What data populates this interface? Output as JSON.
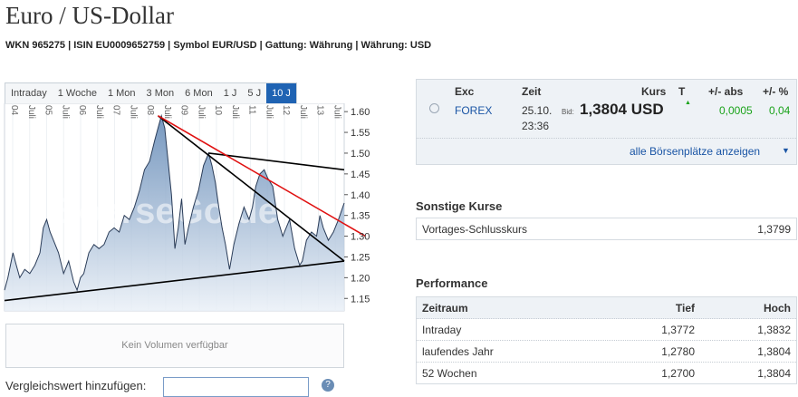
{
  "header": {
    "title": "Euro / US-Dollar",
    "meta": "WKN 965275 | ISIN EU0009652759 | Symbol EUR/USD | Gattung: Währung | Währung: USD"
  },
  "range_tabs": [
    "Intraday",
    "1 Woche",
    "1 Mon",
    "3 Mon",
    "6 Mon",
    "1 J",
    "5 J",
    "10 J"
  ],
  "active_tab": "10 J",
  "chart_data": {
    "type": "area",
    "watermark": "BoerseGo.de",
    "x_labels": [
      "04",
      "Juli",
      "05",
      "Juli",
      "06",
      "Juli",
      "07",
      "Juli",
      "08",
      "Juli",
      "09",
      "Juli",
      "10",
      "Juli",
      "11",
      "Juli",
      "12",
      "Juli",
      "13",
      "Juli"
    ],
    "y_ticks": [
      "1.60",
      "1.55",
      "1.50",
      "1.45",
      "1.40",
      "1.35",
      "1.30",
      "1.25",
      "1.20",
      "1.15"
    ],
    "ylim": [
      1.12,
      1.62
    ],
    "xlim": [
      2003.75,
      2013.82
    ],
    "series": [
      {
        "x": [
          2003.75,
          2003.85,
          2004.0,
          2004.1,
          2004.2,
          2004.35,
          2004.5,
          2004.65,
          2004.8,
          2004.9,
          2005.0,
          2005.1,
          2005.2,
          2005.35,
          2005.5,
          2005.65,
          2005.8,
          2005.9,
          2006.0,
          2006.1,
          2006.25,
          2006.4,
          2006.55,
          2006.7,
          2006.85,
          2007.0,
          2007.15,
          2007.3,
          2007.45,
          2007.6,
          2007.75,
          2007.9,
          2008.05,
          2008.2,
          2008.3,
          2008.4,
          2008.5,
          2008.6,
          2008.7,
          2008.8,
          2008.9,
          2009.0,
          2009.1,
          2009.2,
          2009.35,
          2009.5,
          2009.65,
          2009.8,
          2009.9,
          2010.0,
          2010.1,
          2010.2,
          2010.3,
          2010.42,
          2010.55,
          2010.7,
          2010.85,
          2011.0,
          2011.1,
          2011.2,
          2011.32,
          2011.45,
          2011.55,
          2011.7,
          2011.85,
          2012.0,
          2012.1,
          2012.2,
          2012.35,
          2012.5,
          2012.58,
          2012.7,
          2012.85,
          2013.0,
          2013.1,
          2013.2,
          2013.35,
          2013.5,
          2013.65,
          2013.82
        ],
        "y": [
          1.17,
          1.2,
          1.26,
          1.23,
          1.2,
          1.22,
          1.21,
          1.23,
          1.26,
          1.32,
          1.34,
          1.31,
          1.29,
          1.26,
          1.21,
          1.24,
          1.19,
          1.17,
          1.2,
          1.21,
          1.26,
          1.28,
          1.27,
          1.28,
          1.31,
          1.32,
          1.31,
          1.35,
          1.34,
          1.37,
          1.41,
          1.46,
          1.48,
          1.53,
          1.56,
          1.59,
          1.56,
          1.48,
          1.4,
          1.27,
          1.32,
          1.39,
          1.28,
          1.32,
          1.37,
          1.41,
          1.47,
          1.5,
          1.47,
          1.43,
          1.37,
          1.32,
          1.28,
          1.22,
          1.28,
          1.33,
          1.37,
          1.34,
          1.37,
          1.42,
          1.45,
          1.46,
          1.44,
          1.42,
          1.34,
          1.3,
          1.32,
          1.34,
          1.27,
          1.23,
          1.24,
          1.29,
          1.31,
          1.3,
          1.35,
          1.32,
          1.29,
          1.31,
          1.34,
          1.38
        ]
      }
    ],
    "trendlines": [
      {
        "color": "#000000",
        "x": [
          2008.3,
          2013.82
        ],
        "y": [
          1.59,
          1.24
        ]
      },
      {
        "color": "#000000",
        "x": [
          2009.8,
          2013.82
        ],
        "y": [
          1.5,
          1.46
        ]
      },
      {
        "color": "#000000",
        "x": [
          2003.75,
          2013.82
        ],
        "y": [
          1.145,
          1.24
        ]
      },
      {
        "color": "#e01010",
        "x": [
          2008.3,
          2014.45
        ],
        "y": [
          1.59,
          1.3
        ]
      }
    ],
    "colors": {
      "fill_top": "#5f86b4",
      "fill_bottom": "#eaf0f7",
      "line": "#2a3c58"
    }
  },
  "volume_box": "Kein Volumen verfügbar",
  "compare": {
    "label": "Vergleichswert hinzufügen:",
    "value": ""
  },
  "quote": {
    "headers": {
      "exc": "Exc",
      "zeit": "Zeit",
      "kurs": "Kurs",
      "t": "T",
      "abs": "+/- abs",
      "pct": "+/- %"
    },
    "exchange": "FOREX",
    "date": "25.10.",
    "time": "23:36",
    "bid_label": "Bid:",
    "price": "1,3804 USD",
    "trend_arrow": "▲",
    "change_abs": "0,0005",
    "change_pct": "0,04",
    "all_link": "alle Börsenplätze anzeigen",
    "colors": {
      "positive": "#1aa31a"
    }
  },
  "sonstige": {
    "title": "Sonstige Kurse",
    "rows": [
      {
        "label": "Vortages-Schlusskurs",
        "value": "1,3799"
      }
    ]
  },
  "performance": {
    "title": "Performance",
    "headers": {
      "period": "Zeitraum",
      "low": "Tief",
      "high": "Hoch"
    },
    "rows": [
      {
        "period": "Intraday",
        "low": "1,3772",
        "high": "1,3832"
      },
      {
        "period": "laufendes Jahr",
        "low": "1,2780",
        "high": "1,3804"
      },
      {
        "period": "52 Wochen",
        "low": "1,2700",
        "high": "1,3804"
      }
    ]
  }
}
